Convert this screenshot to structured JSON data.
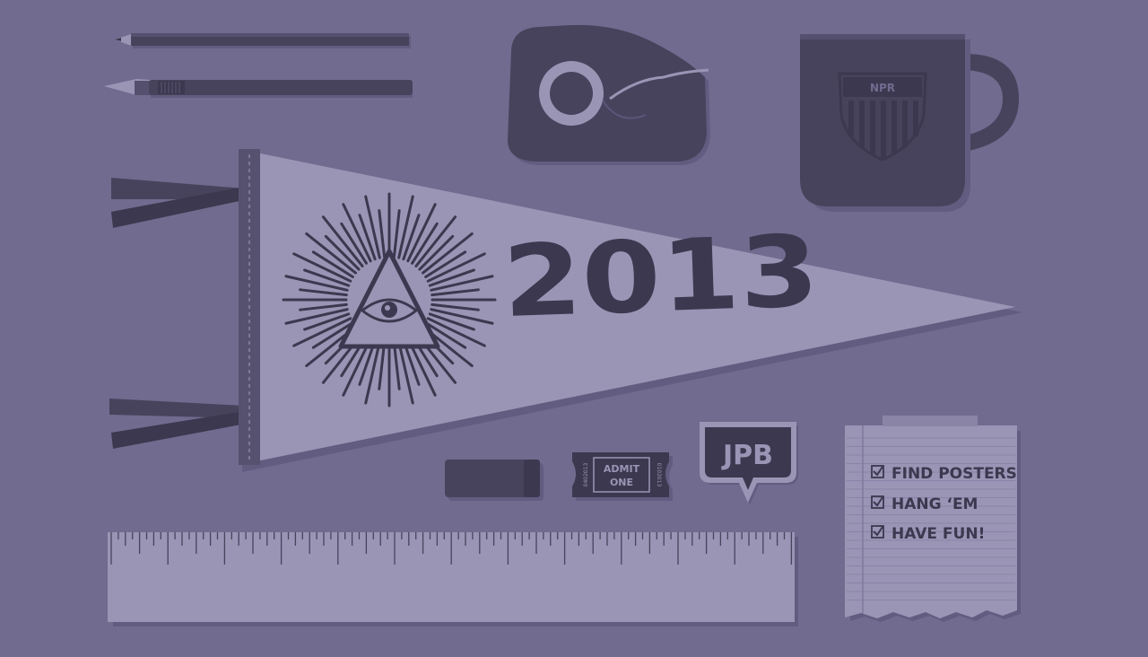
{
  "colors": {
    "background": "#716b8f",
    "light": "#9a95b5",
    "dark": "#47435c",
    "darker": "#3c384f",
    "shadow": "#625c80"
  },
  "pennant": {
    "year": "2013",
    "emblem": "all-seeing-eye-triangle-icon"
  },
  "mug": {
    "badge_text": "NPR"
  },
  "ticket": {
    "line1": "ADMIT",
    "line2": "ONE",
    "serial_left": "0402013",
    "serial_right": "0102013"
  },
  "shield_patch": {
    "text": "JPB"
  },
  "notepad": {
    "items": [
      {
        "text": "FIND POSTERS",
        "checked": true
      },
      {
        "text": "HANG ‘EM",
        "checked": true
      },
      {
        "text": "HAVE FUN!",
        "checked": true
      }
    ]
  },
  "objects": [
    "pencil-icon",
    "craft-knife-icon",
    "tape-dispenser-icon",
    "mug-icon",
    "eraser-icon",
    "ruler-icon"
  ]
}
